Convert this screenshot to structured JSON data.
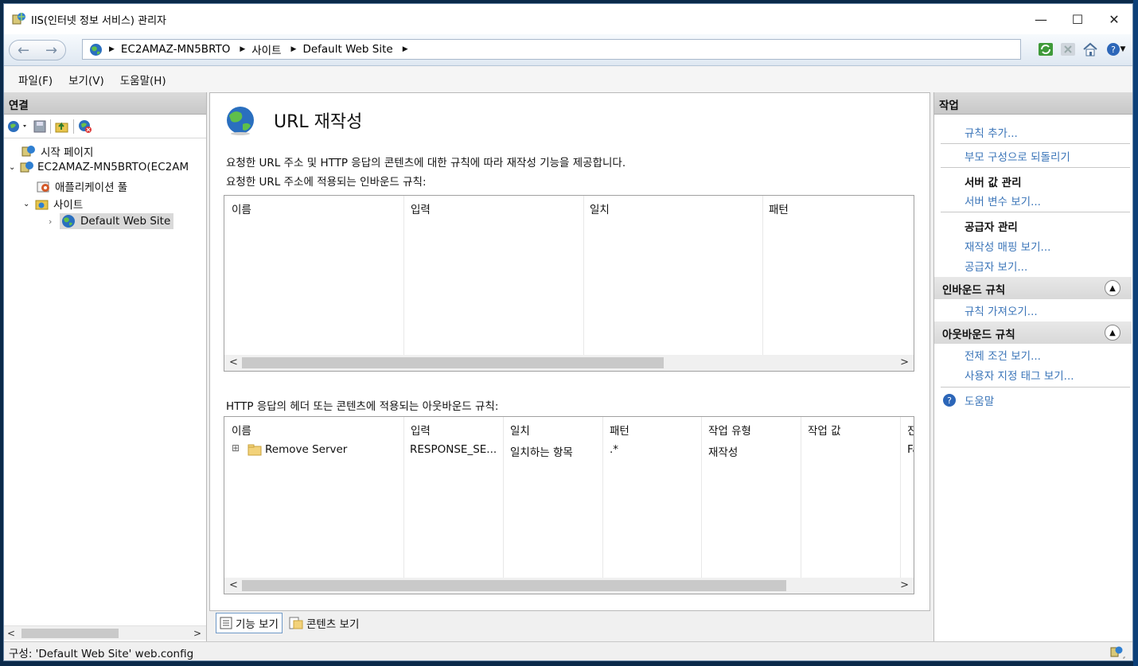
{
  "window": {
    "title": "IIS(인터넷 정보 서비스) 관리자",
    "controls": {
      "minimize": "—",
      "maximize": "☐",
      "close": "✕"
    }
  },
  "address_bar": {
    "crumbs": [
      "EC2AMAZ-MN5BRTO",
      "사이트",
      "Default Web Site"
    ]
  },
  "menu": {
    "items": [
      "파일(F)",
      "보기(V)",
      "도움말(H)"
    ]
  },
  "connections": {
    "title": "연결",
    "tree": [
      {
        "label": "시작 페이지",
        "icon": "start-page-icon"
      },
      {
        "label": "EC2AMAZ-MN5BRTO(EC2AM",
        "icon": "server-icon",
        "expanded": true
      },
      {
        "label": "애플리케이션 풀",
        "icon": "app-pool-icon"
      },
      {
        "label": "사이트",
        "icon": "sites-folder-icon",
        "expanded": true
      },
      {
        "label": "Default Web Site",
        "icon": "globe-icon",
        "selected": true
      }
    ]
  },
  "main": {
    "title": "URL 재작성",
    "description": "요청한 URL 주소 및 HTTP 응답의 콘텐츠에 대한 규칙에 따라 재작성 기능을 제공합니다.",
    "inbound_label": "요청한 URL 주소에 적용되는 인바운드 규칙:",
    "inbound_columns": [
      "이름",
      "입력",
      "일치",
      "패턴"
    ],
    "outbound_label": "HTTP 응답의 헤더 또는 콘텐츠에 적용되는 아웃바운드 규칙:",
    "outbound_columns": [
      "이름",
      "입력",
      "일치",
      "패턴",
      "작업 유형",
      "작업 값",
      "진"
    ],
    "outbound_rows": [
      {
        "expand": "⊞",
        "name": "Remove Server",
        "input": "RESPONSE_SE...",
        "match": "일치하는 항목",
        "pattern": ".*",
        "action_type": "재작성",
        "action_value": "",
        "extra": "Fa"
      }
    ]
  },
  "view_tabs": {
    "features": "기능 보기",
    "content": "콘텐츠 보기"
  },
  "actions": {
    "title": "작업",
    "add_rule": "규칙 추가...",
    "revert_parent": "부모 구성으로 되돌리기",
    "server_values_header": "서버 값 관리",
    "view_server_vars": "서버 변수 보기...",
    "providers_header": "공급자 관리",
    "view_rewrite_maps": "재작성 매핑 보기...",
    "view_providers": "공급자 보기...",
    "inbound_section": "인바운드 규칙",
    "import_rules": "규칙 가져오기...",
    "outbound_section": "아웃바운드 규칙",
    "view_preconditions": "전제 조건 보기...",
    "view_custom_tags": "사용자 지정 태그 보기...",
    "help": "도움말"
  },
  "status_bar": {
    "text": "구성: 'Default Web Site' web.config"
  }
}
